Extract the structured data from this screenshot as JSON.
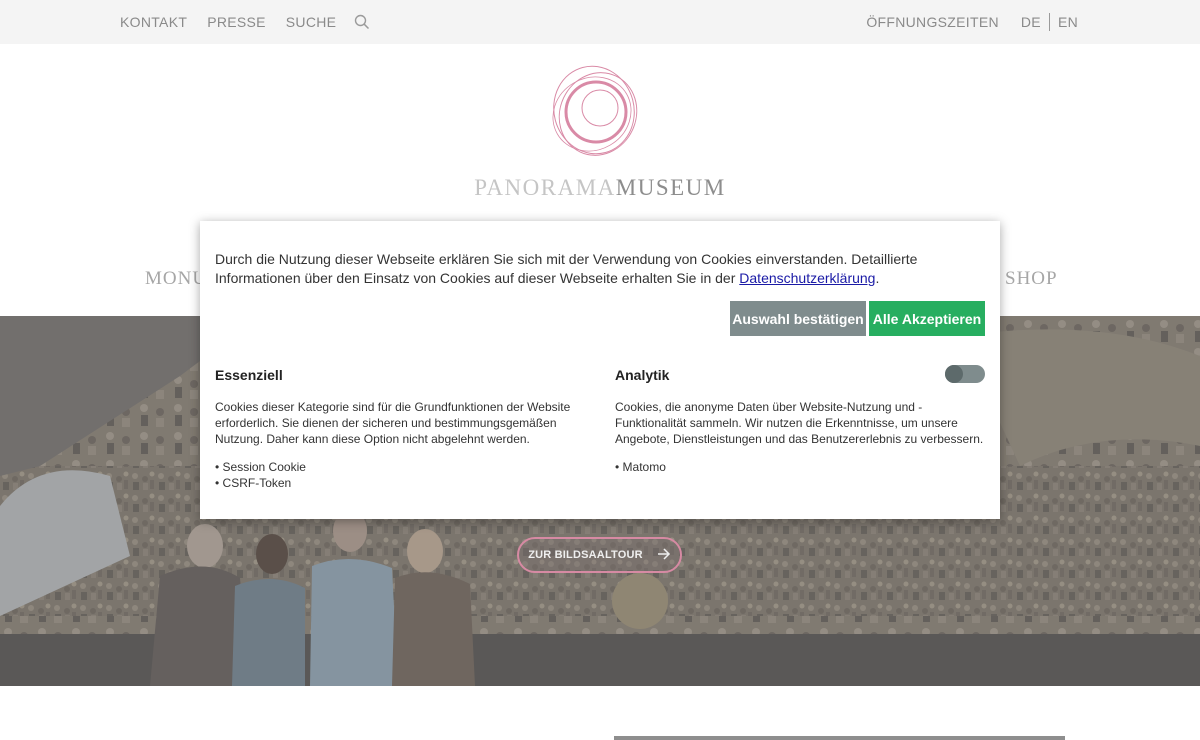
{
  "topbar": {
    "contact": "KONTAKT",
    "press": "PRESSE",
    "search": "SUCHE",
    "opening_hours": "ÖFFNUNGSZEITEN",
    "lang_de": "DE",
    "lang_en": "EN"
  },
  "brand": {
    "word1": "PANORAMA",
    "word2": "MUSEUM",
    "logo_color": "#d98aa6"
  },
  "nav": {
    "left_partial": "MONU",
    "right_partial": "SHOP"
  },
  "hero": {
    "tour_button": "ZUR BILDSAALTOUR"
  },
  "cookie": {
    "intro_text": "Durch die Nutzung dieser Webseite erklären Sie sich mit der Verwendung von Cookies einverstanden. Detaillierte Informationen über den Einsatz von Cookies auf dieser Webseite erhalten Sie in der ",
    "privacy_link": "Datenschutzerklärung",
    "intro_end": ".",
    "confirm_button": "Auswahl bestätigen",
    "accept_all_button": "Alle Akzeptieren",
    "essential": {
      "title": "Essenziell",
      "description": "Cookies dieser Kategorie sind für die Grundfunktionen der Website erforderlich. Sie dienen der sicheren und bestimmungsgemäßen Nutzung. Daher kann diese Option nicht abgelehnt werden.",
      "items": [
        "• Session Cookie",
        "• CSRF-Token"
      ]
    },
    "analytics": {
      "title": "Analytik",
      "description": "Cookies, die anonyme Daten über Website-Nutzung und -Funktionalität sammeln. Wir nutzen die Erkenntnisse, um unsere Angebote, Dienstleistungen und das Benutzererlebnis zu verbessern.",
      "items": [
        "• Matomo"
      ],
      "enabled": false
    },
    "colors": {
      "confirm": "#7f8c8d",
      "accept": "#27ae60",
      "link": "#1a1aa6"
    }
  }
}
